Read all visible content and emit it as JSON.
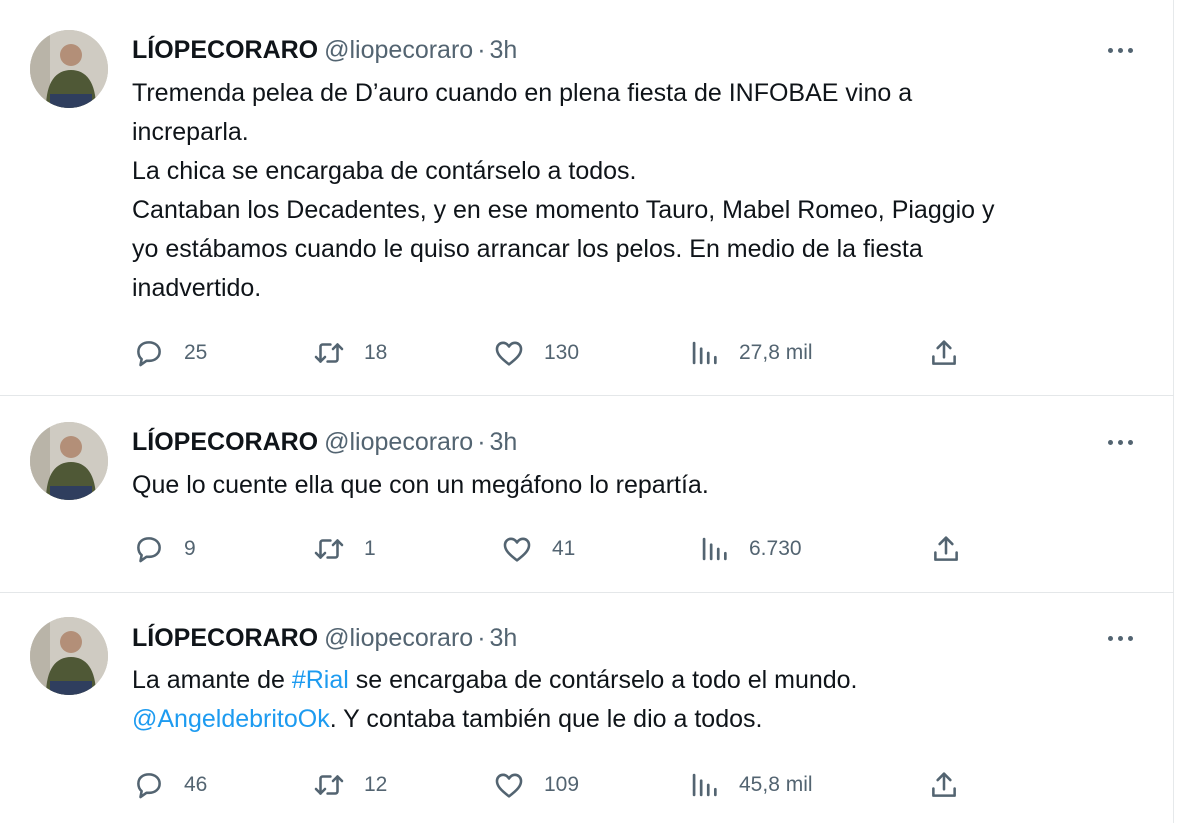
{
  "tweets": [
    {
      "name": "LÍOPECORARO",
      "handle": "@liopecoraro",
      "separator": "·",
      "time": "3h",
      "lines": [
        "Tremenda pelea de D’auro cuando en plena fiesta de INFOBAE vino a",
        "increparla.",
        "La chica se encargaba de contárselo a todos.",
        "Cantaban los Decadentes, y en ese momento Tauro, Mabel Romeo, Piaggio y",
        "yo estábamos cuando le quiso arrancar los pelos. En medio de la fiesta",
        "inadvertido."
      ],
      "replies": "25",
      "retweets": "18",
      "likes": "130",
      "views": "27,8 mil"
    },
    {
      "name": "LÍOPECORARO",
      "handle": "@liopecoraro",
      "separator": "·",
      "time": "3h",
      "lines": [
        "Que lo cuente ella que con un megáfono lo repartía."
      ],
      "replies": "9",
      "retweets": "1",
      "likes": "41",
      "views": "6.730"
    },
    {
      "name": "LÍOPECORARO",
      "handle": "@liopecoraro",
      "separator": "·",
      "time": "3h",
      "line1": {
        "before": "La amante de ",
        "hashtag": "#Rial",
        "after": " se encargaba de contárselo a todo el mundo."
      },
      "line2": {
        "mention": "@AngeldebritoOk",
        "after": ". Y contaba también que le dio a todos."
      },
      "replies": "46",
      "retweets": "12",
      "likes": "109",
      "views": "45,8 mil"
    }
  ],
  "icons": {
    "reply": "reply-icon",
    "retweet": "retweet-icon",
    "like": "heart-icon",
    "views": "views-icon",
    "share": "share-icon",
    "more": "more-icon"
  },
  "colors": {
    "text": "#0f1419",
    "secondary": "#536471",
    "link": "#1d9bf0",
    "divider": "#e4e7e9"
  }
}
